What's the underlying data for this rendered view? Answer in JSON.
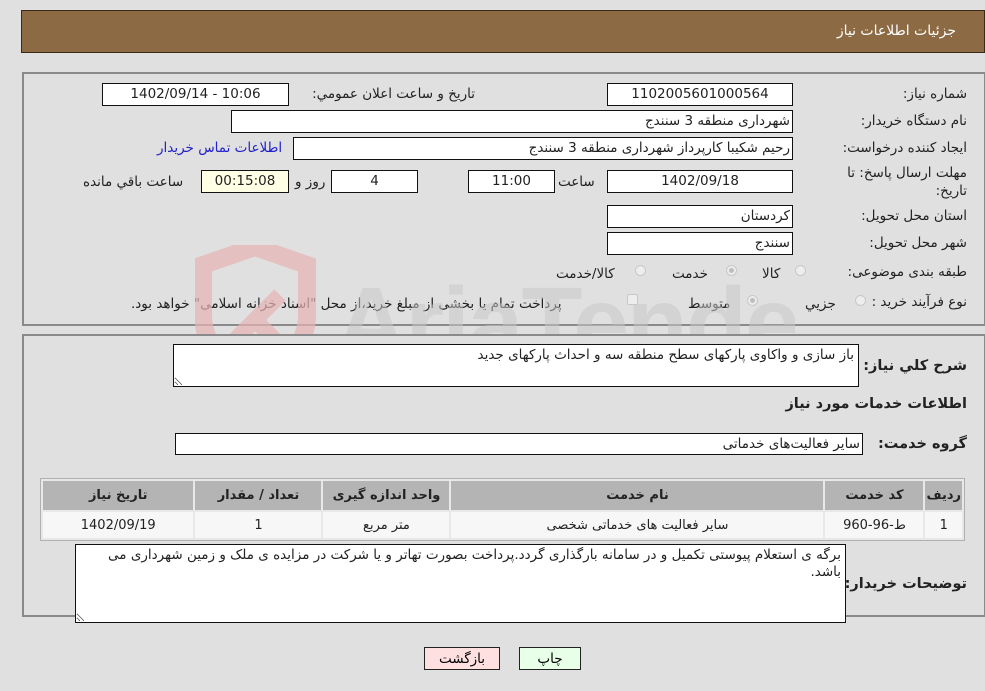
{
  "header": {
    "title": "جزئیات اطلاعات نیاز"
  },
  "details": {
    "need_number_label": "شماره نیاز:",
    "need_number": "1102005601000564",
    "announce_label": "تاریخ و ساعت اعلان عمومي:",
    "announce_value": "1402/09/14 - 10:06",
    "buyer_org_label": "نام دستگاه خریدار:",
    "buyer_org": "شهرداری منطقه 3 سنندج",
    "creator_label": "ایجاد کننده درخواست:",
    "creator": "رحیم شکیبا کارپرداز شهرداری منطقه 3 سنندج",
    "contact_link": "اطلاعات تماس خریدار",
    "deadline_label_line1": "مهلت ارسال پاسخ: تا",
    "deadline_label_line2": "تاریخ:",
    "deadline_date": "1402/09/18",
    "time_label": "ساعت",
    "deadline_time": "11:00",
    "days_value": "4",
    "days_label": "روز و",
    "remaining_value": "00:15:08",
    "remaining_label": "ساعت باقي مانده",
    "province_label": "استان محل تحویل:",
    "province": "کردستان",
    "city_label": "شهر محل تحویل:",
    "city": "سنندج",
    "category_label": "طبقه بندی موضوعی:",
    "category_options": [
      {
        "label": "کالا",
        "checked": false
      },
      {
        "label": "خدمت",
        "checked": true
      },
      {
        "label": "کالا/خدمت",
        "checked": false
      }
    ],
    "process_label": "نوع فرآیند خرید :",
    "process_options": [
      {
        "label": "جزيي",
        "checked": false
      },
      {
        "label": "متوسط",
        "checked": true
      }
    ],
    "treasury_note": "پرداخت تمام یا بخشی از مبلغ خرید،از محل \"اسناد خزانه اسلامی\" خواهد بود."
  },
  "summary": {
    "description_label": "شرح کلي نیاز:",
    "description": "باز سازی و واکاوی پارکهای سطح منطقه سه و احداث پارکهای جدید",
    "services_heading": "اطلاعات خدمات مورد نیاز",
    "service_group_label": "گروه خدمت:",
    "service_group": "سایر فعالیت‌های خدماتی"
  },
  "table": {
    "headers": [
      "ردیف",
      "کد خدمت",
      "نام خدمت",
      "واحد اندازه گیری",
      "تعداد / مقدار",
      "تاریخ نیاز"
    ],
    "rows": [
      [
        "1",
        "ط-96-960",
        "سایر فعالیت های خدماتی شخصی",
        "متر مربع",
        "1",
        "1402/09/19"
      ]
    ]
  },
  "buyer_notes": {
    "label": "توضیحات خریدار:",
    "text": "برگه ی استعلام پیوستی تکمیل و در سامانه بارگذاری گردد.پرداخت بصورت تهاتر و یا شرکت در مزایده ی ملک و زمین شهرداری می باشد."
  },
  "buttons": {
    "print": "چاپ",
    "back": "بازگشت"
  },
  "watermark": {
    "text": "AriaTender.net"
  }
}
